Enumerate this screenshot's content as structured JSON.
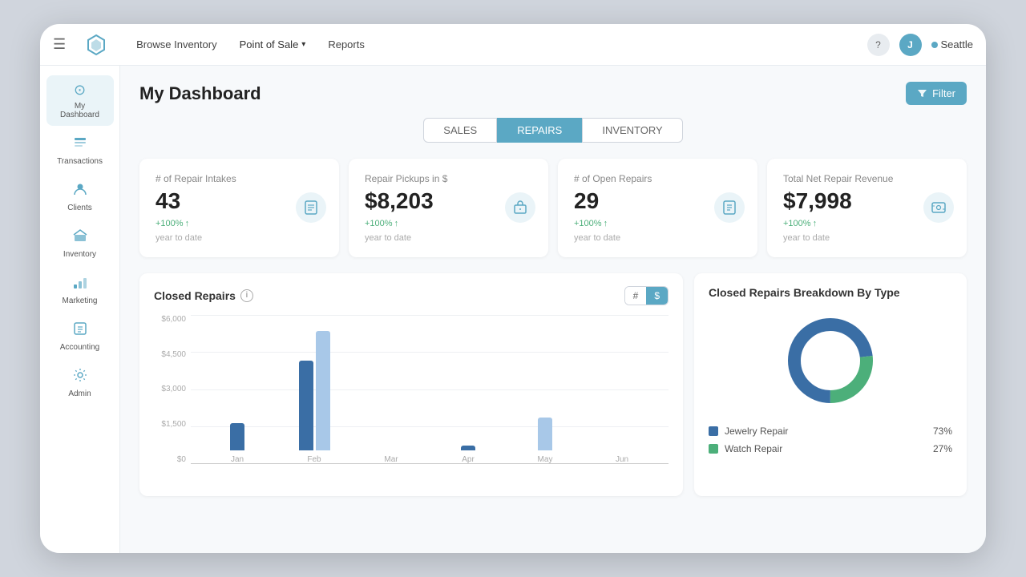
{
  "nav": {
    "hamburger": "☰",
    "links": [
      {
        "label": "Browse Inventory",
        "active": false
      },
      {
        "label": "Point of Sale",
        "active": true,
        "hasDropdown": true
      },
      {
        "label": "Reports",
        "active": false
      }
    ],
    "help_icon": "?",
    "user_initial": "J",
    "location_label": "Seattle"
  },
  "sidebar": {
    "items": [
      {
        "label": "My Dashboard",
        "icon": "⊙",
        "active": true
      },
      {
        "label": "Transactions",
        "icon": "🗒",
        "active": false
      },
      {
        "label": "Clients",
        "icon": "👤",
        "active": false
      },
      {
        "label": "Inventory",
        "icon": "📦",
        "active": false
      },
      {
        "label": "Marketing",
        "icon": "🛒",
        "active": false
      },
      {
        "label": "Accounting",
        "icon": "📊",
        "active": false
      },
      {
        "label": "Admin",
        "icon": "🔧",
        "active": false
      }
    ]
  },
  "page": {
    "title": "My Dashboard",
    "filter_label": "Filter"
  },
  "tabs": [
    {
      "label": "SALES",
      "active": false
    },
    {
      "label": "REPAIRS",
      "active": true
    },
    {
      "label": "INVENTORY",
      "active": false
    }
  ],
  "stat_cards": [
    {
      "title": "# of Repair Intakes",
      "value": "43",
      "change": "+100%",
      "period": "year to date",
      "icon": "📋"
    },
    {
      "title": "Repair Pickups in $",
      "value": "$8,203",
      "change": "+100%",
      "period": "year to date",
      "icon": "📦"
    },
    {
      "title": "# of Open Repairs",
      "value": "29",
      "change": "+100%",
      "period": "year to date",
      "icon": "📋"
    },
    {
      "title": "Total Net Repair Revenue",
      "value": "$7,998",
      "change": "+100%",
      "period": "year to date",
      "icon": "💳"
    }
  ],
  "closed_repairs_chart": {
    "title": "Closed Repairs",
    "toggle_hash": "#",
    "toggle_dollar": "$",
    "y_labels": [
      "$6,000",
      "$4,500",
      "$3,000",
      "$1,500",
      "$0"
    ],
    "bars": [
      {
        "month": "Jan",
        "dark_pct": 0.18,
        "light_pct": 0
      },
      {
        "month": "Feb",
        "dark_pct": 0.6,
        "light_pct": 0.8
      },
      {
        "month": "Mar",
        "dark_pct": 0,
        "light_pct": 0
      },
      {
        "month": "Apr",
        "dark_pct": 0.03,
        "light_pct": 0
      },
      {
        "month": "May",
        "dark_pct": 0,
        "light_pct": 0.22
      },
      {
        "month": "Jun",
        "dark_pct": 0,
        "light_pct": 0
      }
    ]
  },
  "breakdown_chart": {
    "title": "Closed Repairs Breakdown By Type",
    "legend": [
      {
        "label": "Jewelry Repair",
        "pct": "73%",
        "color": "#3a6ea5"
      },
      {
        "label": "Watch Repair",
        "pct": "27%",
        "color": "#4caf7a"
      }
    ],
    "donut": {
      "jewelry_deg": 263,
      "watch_deg": 97
    }
  }
}
